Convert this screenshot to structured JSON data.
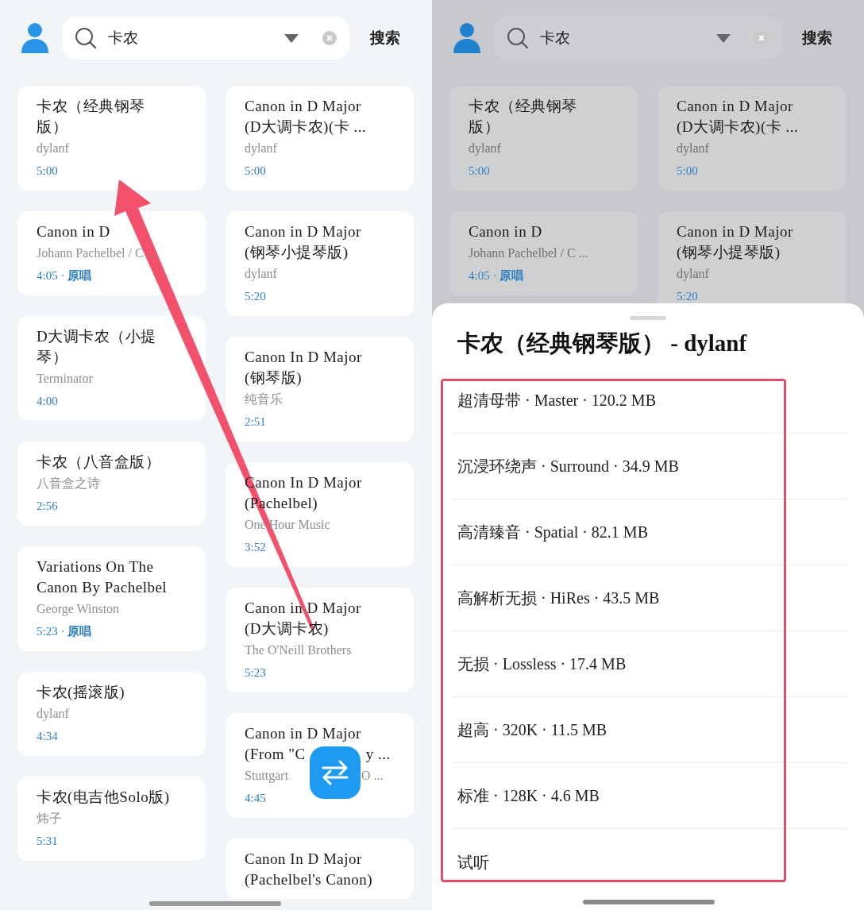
{
  "left_screen": {
    "search": {
      "value": "卡农",
      "button": "搜索"
    },
    "columns": [
      [
        {
          "title_lines": [
            "卡农（经典钢琴",
            "版）"
          ],
          "artist": "dylanf",
          "meta": "5:00"
        },
        {
          "title_lines": [
            "Canon in D"
          ],
          "artist": "Johann Pachelbel / C ...",
          "meta": "4:05 · **原唱**"
        },
        {
          "title_lines": [
            "D大调卡农（小提",
            "琴）"
          ],
          "artist": "Terminator",
          "meta": "4:00"
        },
        {
          "title_lines": [
            "卡农（八音盒版）"
          ],
          "artist": "八音盒之诗",
          "meta": "2:56"
        },
        {
          "title_lines": [
            "Variations On The",
            "Canon By Pachelbel"
          ],
          "artist": "George Winston",
          "meta": "5:23 · **原唱**"
        },
        {
          "title_lines": [
            "卡农(摇滚版)"
          ],
          "artist": "dylanf",
          "meta": "4:34"
        },
        {
          "title_lines": [
            "卡农(电吉他Solo版)"
          ],
          "artist": "炜子",
          "meta": "5:31"
        }
      ],
      [
        {
          "title_lines": [
            "Canon in D Major",
            "(D大调卡农)(卡 ..."
          ],
          "artist": "dylanf",
          "meta": "5:00"
        },
        {
          "title_lines": [
            "Canon in D Major",
            "(钢琴小提琴版)"
          ],
          "artist": "dylanf",
          "meta": "5:20"
        },
        {
          "title_lines": [
            "Canon In D Major",
            "(钢琴版)"
          ],
          "artist": "纯音乐",
          "meta": "2:51"
        },
        {
          "title_lines": [
            "Canon In D Major",
            "(Pachelbel)"
          ],
          "artist": "One Hour Music",
          "meta": "3:52"
        },
        {
          "title_lines": [
            "Canon in D Major",
            "(D大调卡农)"
          ],
          "artist": "The O'Neill Brothers",
          "meta": "5:23"
        },
        {
          "title_lines": [
            "Canon in D Major",
            [
              "(From \"C",
              "y  ..."
            ]
          ],
          "artist": [
            "Stuttgart",
            "O ..."
          ],
          "meta": "4:45"
        },
        {
          "title_lines": [
            "Canon In D Major",
            "(Pachelbel's Canon)"
          ]
        }
      ]
    ]
  },
  "right_screen": {
    "search": {
      "value": "卡农",
      "button": "搜索"
    },
    "columns": [
      [
        {
          "title_lines": [
            "卡农（经典钢琴",
            "版）"
          ],
          "artist": "dylanf",
          "meta": "5:00"
        },
        {
          "title_lines": [
            "Canon in D"
          ],
          "artist": "Johann Pachelbel / C ...",
          "meta": "4:05 · **原唱**"
        }
      ],
      [
        {
          "title_lines": [
            "Canon in D Major",
            "(D大调卡农)(卡 ..."
          ],
          "artist": "dylanf",
          "meta": "5:00"
        },
        {
          "title_lines": [
            "Canon in D Major",
            "(钢琴小提琴版)"
          ],
          "artist": "dylanf",
          "meta": "5:20"
        }
      ]
    ],
    "sheet": {
      "title": "卡农（经典钢琴版） - dylanf",
      "options": [
        "超清母带 · Master · 120.2 MB",
        "沉浸环绕声 · Surround · 34.9 MB",
        "高清臻音 · Spatial · 82.1 MB",
        "高解析无损 · HiRes · 43.5 MB",
        "无损 · Lossless · 17.4 MB",
        "超高 · 320K · 11.5 MB",
        "标准 · 128K · 4.6 MB",
        "试听"
      ]
    }
  }
}
